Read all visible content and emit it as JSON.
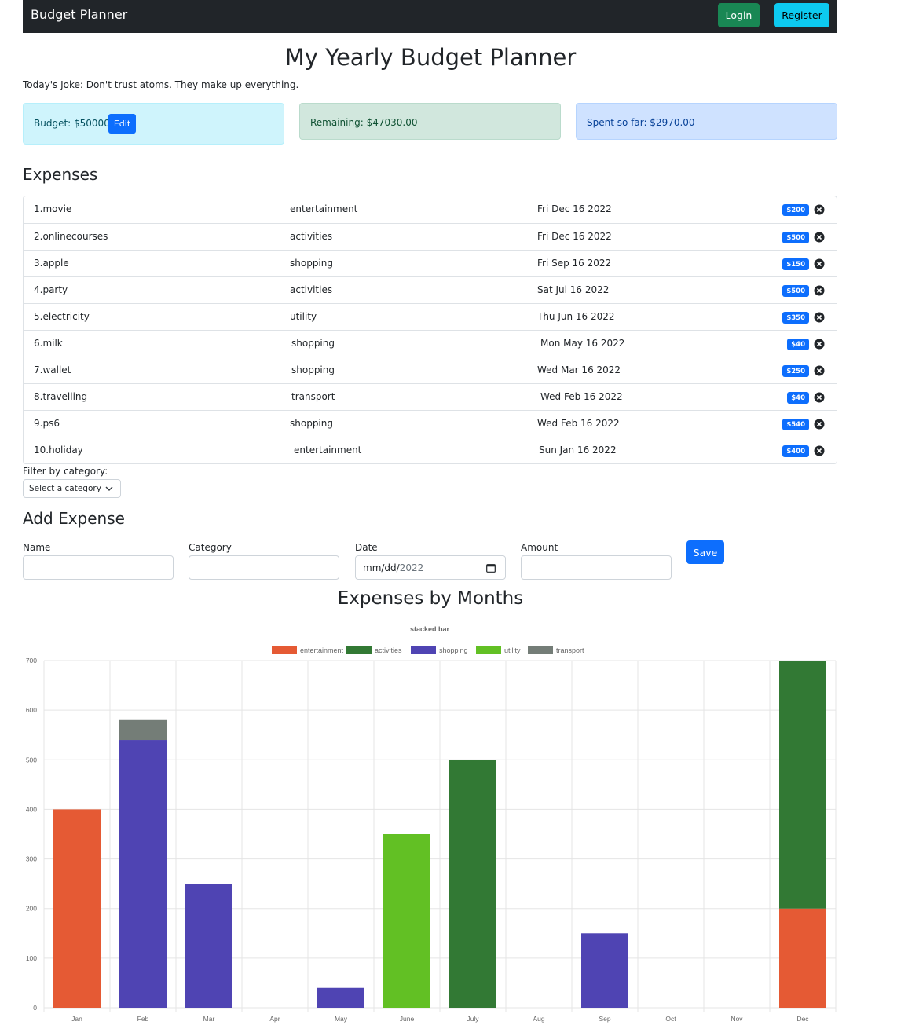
{
  "navbar": {
    "brand": "Budget Planner",
    "login_label": "Login",
    "register_label": "Register"
  },
  "page_title": "My Yearly Budget Planner",
  "joke": "Today's Joke: Don't trust atoms. They make up everything.",
  "summary": {
    "budget_text": "Budget: $50000",
    "edit_label": "Edit",
    "remaining_text": "Remaining: $47030.00",
    "spent_text": "Spent so far: $2970.00"
  },
  "expenses": {
    "heading": "Expenses",
    "items": [
      {
        "name": "1.movie",
        "category": "entertainment",
        "date": "Fri Dec 16 2022",
        "amount": "$200"
      },
      {
        "name": "2.onlinecourses",
        "category": "activities",
        "date": "Fri Dec 16 2022",
        "amount": "$500"
      },
      {
        "name": "3.apple",
        "category": "shopping",
        "date": "Fri Sep 16 2022",
        "amount": "$150"
      },
      {
        "name": "4.party",
        "category": "activities",
        "date": "Sat Jul 16 2022",
        "amount": "$500"
      },
      {
        "name": "5.electricity",
        "category": "utility",
        "date": "Thu Jun 16 2022",
        "amount": "$350"
      },
      {
        "name": "6.milk",
        "category": "shopping",
        "date": "Mon May 16 2022",
        "amount": "$40"
      },
      {
        "name": "7.wallet",
        "category": "shopping",
        "date": "Wed Mar 16 2022",
        "amount": "$250"
      },
      {
        "name": "8.travelling",
        "category": "transport",
        "date": "Wed Feb 16 2022",
        "amount": "$40"
      },
      {
        "name": "9.ps6",
        "category": "shopping",
        "date": "Wed Feb 16 2022",
        "amount": "$540"
      },
      {
        "name": "10.holiday",
        "category": "entertainment",
        "date": "Sun Jan 16 2022",
        "amount": "$400"
      }
    ]
  },
  "filter": {
    "label": "Filter by category:",
    "selected": "Select a category"
  },
  "add_expense": {
    "heading": "Add Expense",
    "name_label": "Name",
    "category_label": "Category",
    "date_label": "Date",
    "date_value_prefix": "mm/dd/",
    "date_value_year": "2022",
    "amount_label": "Amount",
    "save_label": "Save"
  },
  "chart_section_title": "Expenses by Months",
  "chart_data": {
    "type": "bar",
    "stacked": true,
    "title": "stacked bar",
    "legend_position": "top",
    "categories": [
      "Jan",
      "Feb",
      "Mar",
      "Apr",
      "May",
      "June",
      "July",
      "Aug",
      "Sep",
      "Oct",
      "Nov",
      "Dec"
    ],
    "ylim": [
      0,
      700
    ],
    "yticks": [
      0,
      100,
      200,
      300,
      400,
      500,
      600,
      700
    ],
    "grid": true,
    "series": [
      {
        "name": "entertainment",
        "color": "#e55a34",
        "values": [
          400,
          0,
          0,
          0,
          0,
          0,
          0,
          0,
          0,
          0,
          0,
          200
        ]
      },
      {
        "name": "activities",
        "color": "#327934",
        "values": [
          0,
          0,
          0,
          0,
          0,
          0,
          500,
          0,
          0,
          0,
          0,
          500
        ]
      },
      {
        "name": "shopping",
        "color": "#4f44b3",
        "values": [
          0,
          540,
          250,
          0,
          40,
          0,
          0,
          0,
          150,
          0,
          0,
          0
        ]
      },
      {
        "name": "utility",
        "color": "#62c024",
        "values": [
          0,
          0,
          0,
          0,
          0,
          350,
          0,
          0,
          0,
          0,
          0,
          0
        ]
      },
      {
        "name": "transport",
        "color": "#747d77",
        "values": [
          0,
          40,
          0,
          0,
          0,
          0,
          0,
          0,
          0,
          0,
          0,
          0
        ]
      }
    ]
  }
}
